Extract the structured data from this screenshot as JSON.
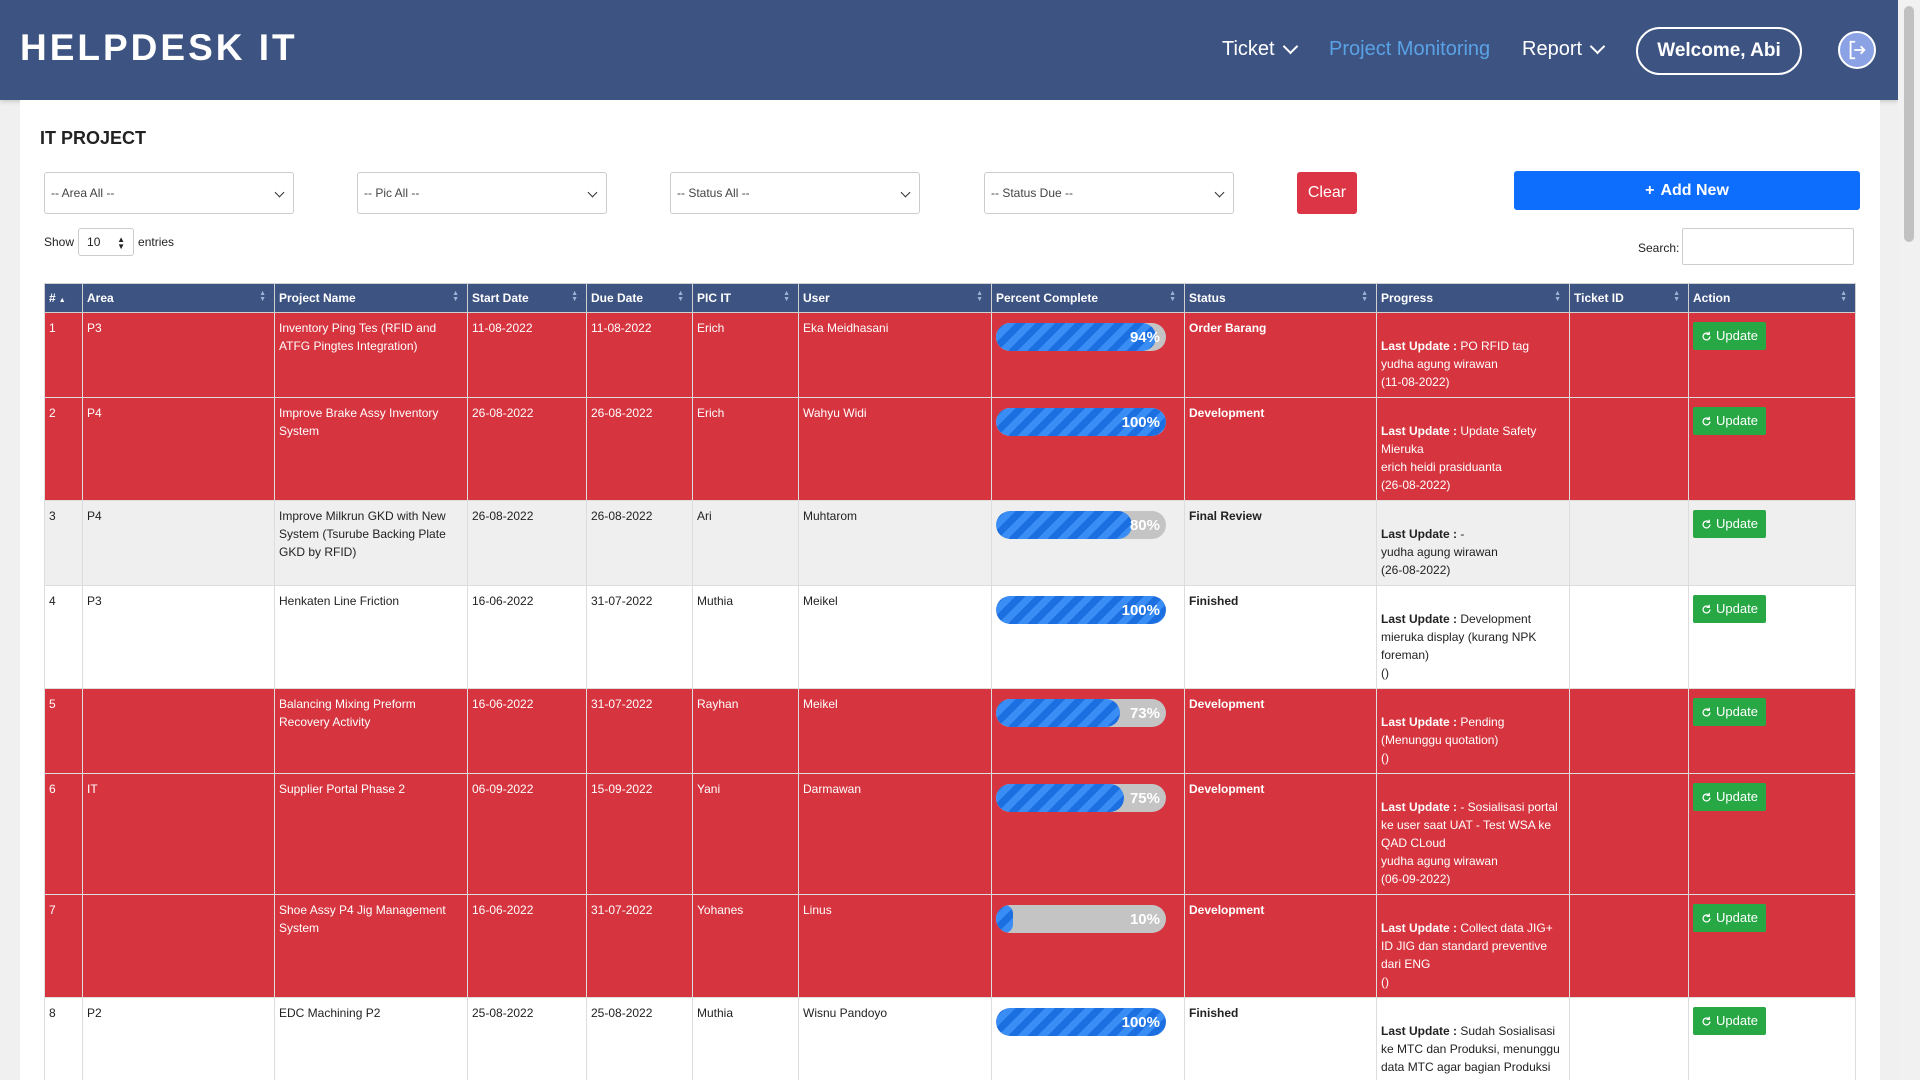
{
  "nav": {
    "brand": "HELPDESK IT",
    "items": [
      {
        "label": "Ticket"
      },
      {
        "label": "Project Monitoring"
      },
      {
        "label": "Report"
      }
    ],
    "welcome": "Welcome, Abi"
  },
  "page": {
    "title": "IT PROJECT",
    "filters": [
      "-- Area All --",
      "-- Pic All --",
      "-- Status All --",
      "-- Status Due --"
    ],
    "clear_label": "Clear",
    "add_label": "Add New",
    "show_label": "Show",
    "show_value": "10",
    "entries_label": "entries",
    "search_label": "Search:"
  },
  "table": {
    "headers": [
      "#",
      "Area",
      "Project Name",
      "Start Date",
      "Due Date",
      "PIC IT",
      "User",
      "Percent Complete",
      "Status",
      "Progress",
      "Ticket ID",
      "Action"
    ],
    "last_update_label": "Last Update :",
    "update_label": "Update",
    "rows": [
      {
        "no": "1",
        "area": "P3",
        "project": "Inventory Ping Tes (RFID and ATFG Pingtes Integration)",
        "start": "11-08-2022",
        "due": "11-08-2022",
        "pic": "Erich",
        "user": "Eka Meidhasani",
        "percent": 94,
        "percent_label": "94%",
        "status": "Order Barang",
        "progress": "PO RFID tag",
        "updater": "yudha agung wirawan",
        "update_date": "(11-08-2022)",
        "ticket": "",
        "color": "red"
      },
      {
        "no": "2",
        "area": "P4",
        "project": "Improve Brake Assy Inventory System",
        "start": "26-08-2022",
        "due": "26-08-2022",
        "pic": "Erich",
        "user": "Wahyu Widi",
        "percent": 100,
        "percent_label": "100%",
        "status": "Development",
        "progress": "Update Safety Mieruka",
        "updater": "erich heidi prasiduanta",
        "update_date": "(26-08-2022)",
        "ticket": "",
        "color": "red"
      },
      {
        "no": "3",
        "area": "P4",
        "project": "Improve Milkrun GKD with New System (Tsurube Backing Plate GKD by RFID)",
        "start": "26-08-2022",
        "due": "26-08-2022",
        "pic": "Ari",
        "user": "Muhtarom",
        "percent": 80,
        "percent_label": "80%",
        "status": "Final Review",
        "progress": "-",
        "updater": "yudha agung wirawan",
        "update_date": "(26-08-2022)",
        "ticket": "",
        "color": "gray"
      },
      {
        "no": "4",
        "area": "P3",
        "project": "Henkaten Line Friction",
        "start": "16-06-2022",
        "due": "31-07-2022",
        "pic": "Muthia",
        "user": "Meikel",
        "percent": 100,
        "percent_label": "100%",
        "status": "Finished",
        "progress": "Development mieruka display (kurang NPK foreman)",
        "updater": "",
        "update_date": "()",
        "ticket": "",
        "color": "white"
      },
      {
        "no": "5",
        "area": "",
        "project": "Balancing Mixing Preform Recovery Activity",
        "start": "16-06-2022",
        "due": "31-07-2022",
        "pic": "Rayhan",
        "user": "Meikel",
        "percent": 73,
        "percent_label": "73%",
        "status": "Development",
        "progress": "Pending (Menunggu quotation)",
        "updater": "",
        "update_date": "()",
        "ticket": "",
        "color": "red"
      },
      {
        "no": "6",
        "area": "IT",
        "project": "Supplier Portal Phase 2",
        "start": "06-09-2022",
        "due": "15-09-2022",
        "pic": "Yani",
        "user": "Darmawan",
        "percent": 75,
        "percent_label": "75%",
        "status": "Development",
        "progress": "- Sosialisasi portal ke user saat UAT - Test WSA ke QAD CLoud",
        "updater": "yudha agung wirawan",
        "update_date": "(06-09-2022)",
        "ticket": "",
        "color": "red"
      },
      {
        "no": "7",
        "area": "",
        "project": "Shoe Assy P4 Jig Management System",
        "start": "16-06-2022",
        "due": "31-07-2022",
        "pic": "Yohanes",
        "user": "Linus",
        "percent": 10,
        "percent_label": "10%",
        "status": "Development",
        "progress": "Collect data JIG+ ID JIG dan standard preventive dari ENG",
        "updater": "",
        "update_date": "()",
        "ticket": "",
        "color": "red"
      },
      {
        "no": "8",
        "area": "P2",
        "project": "EDC Machining P2",
        "start": "25-08-2022",
        "due": "25-08-2022",
        "pic": "Muthia",
        "user": "Wisnu Pandoyo",
        "percent": 100,
        "percent_label": "100%",
        "status": "Finished",
        "progress": "Sudah Sosialisasi ke MTC dan Produksi, menunggu data MTC agar bagian Produksi bisa segera melakukan proses EDC",
        "updater": "",
        "update_date": "",
        "ticket": "",
        "color": "white"
      }
    ]
  },
  "colors": {
    "navbar": "#3d5382",
    "active_nav": "#5aa2e6",
    "danger": "#dc3545",
    "primary": "#0d6efd",
    "success": "#28a745"
  }
}
